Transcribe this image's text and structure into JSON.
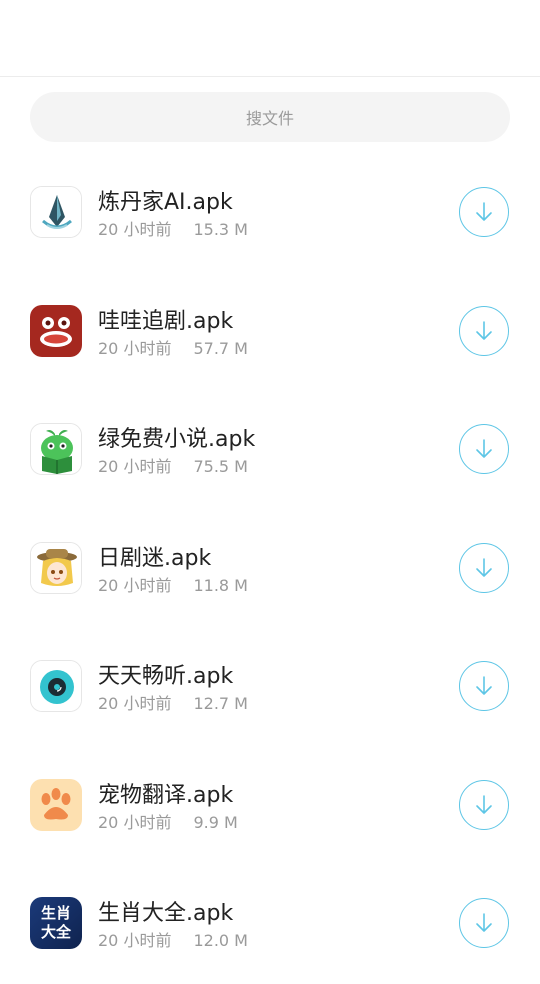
{
  "search": {
    "placeholder": "搜文件"
  },
  "files": [
    {
      "name": "炼丹家AI.apk",
      "time": "20 小时前",
      "size": "15.3 M",
      "icon": "crystal-ai-app-icon"
    },
    {
      "name": "哇哇追剧.apk",
      "time": "20 小时前",
      "size": "57.7 M",
      "icon": "wawa-drama-app-icon"
    },
    {
      "name": "绿免费小说.apk",
      "time": "20 小时前",
      "size": "75.5 M",
      "icon": "green-novel-app-icon"
    },
    {
      "name": "日剧迷.apk",
      "time": "20 小时前",
      "size": "11.8 M",
      "icon": "anime-girl-app-icon"
    },
    {
      "name": "天天畅听.apk",
      "time": "20 小时前",
      "size": "12.7 M",
      "icon": "vinyl-audio-app-icon"
    },
    {
      "name": "宠物翻译.apk",
      "time": "20 小时前",
      "size": "9.9 M",
      "icon": "paw-app-icon"
    },
    {
      "name": "生肖大全.apk",
      "time": "20 小时前",
      "size": "12.0 M",
      "icon": "zodiac-app-icon",
      "icon_text": [
        "生肖",
        "大全"
      ]
    }
  ]
}
